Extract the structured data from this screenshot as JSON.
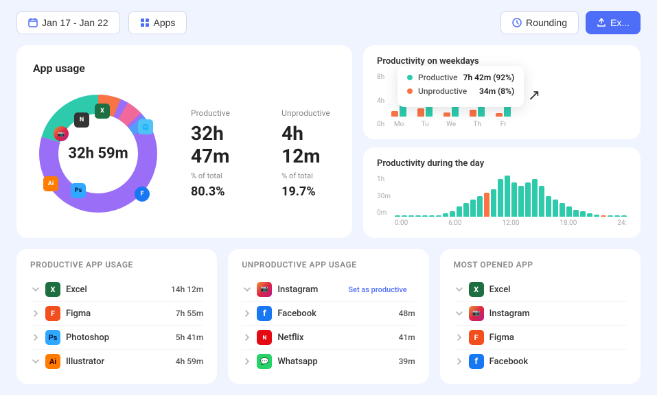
{
  "topbar": {
    "date_range": "Jan 17 - Jan 22",
    "apps_label": "Apps",
    "rounding_label": "Rounding",
    "export_label": "Ex..."
  },
  "app_usage": {
    "title": "App usage",
    "total_time": "32h 59m",
    "productive_label": "Productive",
    "productive_value": "32h 47m",
    "productive_percent_label": "% of total",
    "productive_percent": "80.3%",
    "unproductive_label": "Unproductive",
    "unproductive_value": "4h 12m",
    "unproductive_percent_label": "% of total",
    "unproductive_percent": "19.7%"
  },
  "tooltip": {
    "productive_label": "Productive",
    "productive_value": "7h 42m (92%)",
    "unproductive_label": "Unproductive",
    "unproductive_value": "34m (8%)"
  },
  "weekday_chart": {
    "title": "Productivity on weekdays",
    "y_labels": [
      "8h",
      "4h",
      "0h"
    ],
    "days": [
      {
        "label": "Mo",
        "productive": 55,
        "unproductive": 8
      },
      {
        "label": "Tu",
        "productive": 65,
        "unproductive": 12
      },
      {
        "label": "We",
        "productive": 58,
        "unproductive": 6
      },
      {
        "label": "Th",
        "productive": 62,
        "unproductive": 10
      },
      {
        "label": "Fr",
        "productive": 50,
        "unproductive": 5
      }
    ]
  },
  "intraday_chart": {
    "title": "Productivity during the day",
    "y_labels": [
      "1h",
      "30m",
      "0m"
    ],
    "x_labels": [
      "0:00",
      "6:00",
      "12:00",
      "18:00",
      "24:"
    ]
  },
  "productive_apps": {
    "title": "Productive app usage",
    "apps": [
      {
        "name": "Excel",
        "time": "14h 12m",
        "icon_type": "excel"
      },
      {
        "name": "Figma",
        "time": "7h 55m",
        "icon_type": "figma"
      },
      {
        "name": "Photoshop",
        "time": "5h 41m",
        "icon_type": "photoshop"
      },
      {
        "name": "Illustrator",
        "time": "4h 59m",
        "icon_type": "illustrator"
      }
    ]
  },
  "unproductive_apps": {
    "title": "Unproductive app usage",
    "apps": [
      {
        "name": "Instagram",
        "time": "",
        "icon_type": "instagram",
        "set_productive": "Set as productive"
      },
      {
        "name": "Facebook",
        "time": "48m",
        "icon_type": "facebook"
      },
      {
        "name": "Netflix",
        "time": "41m",
        "icon_type": "netflix"
      },
      {
        "name": "Whatsapp",
        "time": "39m",
        "icon_type": "whatsapp"
      }
    ]
  },
  "most_opened": {
    "title": "Most opened app",
    "apps": [
      {
        "name": "Excel",
        "icon_type": "excel"
      },
      {
        "name": "Instagram",
        "icon_type": "instagram"
      },
      {
        "name": "Figma",
        "icon_type": "figma"
      },
      {
        "name": "Facebook",
        "icon_type": "facebook"
      }
    ]
  }
}
